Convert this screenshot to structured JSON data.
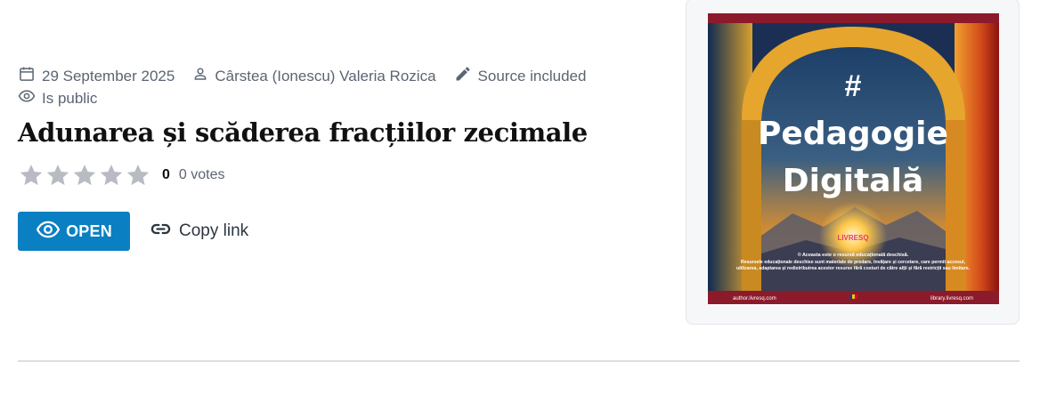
{
  "meta": {
    "date": "29 September 2025",
    "author": "Cârstea (Ionescu) Valeria Rozica",
    "source": "Source included",
    "visibility": "Is public"
  },
  "resource": {
    "title": "Adunarea și scăderea fracțiilor zecimale"
  },
  "rating": {
    "max_stars": 5,
    "filled_stars": 0,
    "count": "0",
    "votes_label": "0 votes"
  },
  "actions": {
    "open_label": "OPEN",
    "copy_link_label": "Copy link"
  },
  "cover": {
    "hash": "#",
    "line1": "Pedagogie",
    "line2": "Digitală",
    "brand": "LIVRESQ",
    "notice_line1": "© Aceasta este o resursă educațională deschisă.",
    "notice_line2": "Resursele educaționale deschise sunt materiale de predare, învățare și cercetare, care permit accesul,",
    "notice_line3": "utilizarea, adaptarea și redistribuirea acestor resurse fără costuri de către alții și fără restricții sau limitare.",
    "footer_left": "author.livresq.com",
    "footer_right": "library.livresq.com"
  },
  "colors": {
    "accent": "#0a7fc1",
    "meta_text": "#5b6472",
    "star_empty": "#b8bcc2",
    "cover_band": "#8b1a2b"
  }
}
